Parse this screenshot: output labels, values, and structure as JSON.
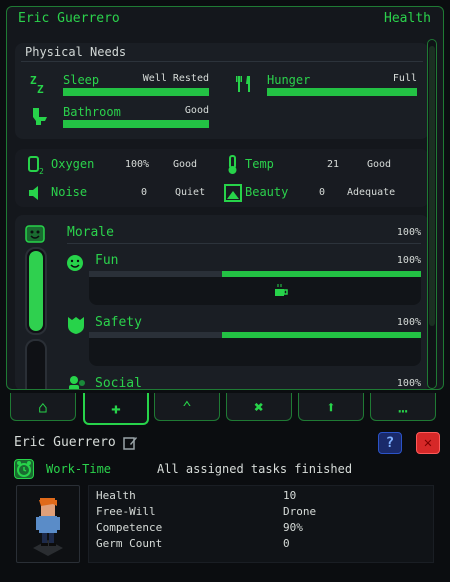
{
  "panel": {
    "title": "Eric Guerrero",
    "tab": "Health"
  },
  "physical": {
    "header": "Physical Needs",
    "needs": [
      {
        "name": "Sleep",
        "status": "Well Rested",
        "level": 1.0,
        "icon": "zzz-icon"
      },
      {
        "name": "Hunger",
        "status": "Full",
        "level": 1.0,
        "icon": "fork-knife-icon"
      },
      {
        "name": "Bathroom",
        "status": "Good",
        "level": 1.0,
        "icon": "toilet-icon"
      }
    ]
  },
  "environment": {
    "items": [
      {
        "name": "Oxygen",
        "value": "100%",
        "status": "Good",
        "icon": "o2-icon"
      },
      {
        "name": "Temp",
        "value": "21",
        "status": "Good",
        "icon": "thermometer-icon"
      },
      {
        "name": "Noise",
        "value": "0",
        "status": "Quiet",
        "icon": "speaker-icon"
      },
      {
        "name": "Beauty",
        "value": "0",
        "status": "Adequate",
        "icon": "frame-icon"
      }
    ]
  },
  "morale": {
    "label": "Morale",
    "value": "100%",
    "level": 1.0,
    "sub": [
      {
        "name": "Fun",
        "value": "100%",
        "icon": "smiley-icon",
        "level": 1.0,
        "item_icon": "coffee-cup-icon"
      },
      {
        "name": "Safety",
        "value": "100%",
        "icon": "shield-icon",
        "level": 1.0
      },
      {
        "name": "Social",
        "value": "100%",
        "icon": "people-icon",
        "level": 1.0
      }
    ]
  },
  "tabs": [
    {
      "icon": "home-icon",
      "glyph": "⌂"
    },
    {
      "icon": "plus-icon",
      "glyph": "✚"
    },
    {
      "icon": "rank-icon",
      "glyph": "⌃"
    },
    {
      "icon": "tools-icon",
      "glyph": "✖"
    },
    {
      "icon": "upgrade-icon",
      "glyph": "⬆"
    },
    {
      "icon": "more-icon",
      "glyph": "…"
    }
  ],
  "bottom": {
    "name": "Eric Guerrero",
    "work_label": "Work-Time",
    "work_status": "All assigned tasks finished",
    "help": "?",
    "close": "✕",
    "stats": [
      {
        "key": "Health",
        "value": "10"
      },
      {
        "key": "Free-Will",
        "value": "Drone"
      },
      {
        "key": "Competence",
        "value": "90%"
      },
      {
        "key": "Germ Count",
        "value": "0"
      }
    ]
  },
  "colors": {
    "accent": "#27d34a",
    "panel_bg": "#14171c",
    "close": "#d62828",
    "help": "#2b53c8"
  }
}
